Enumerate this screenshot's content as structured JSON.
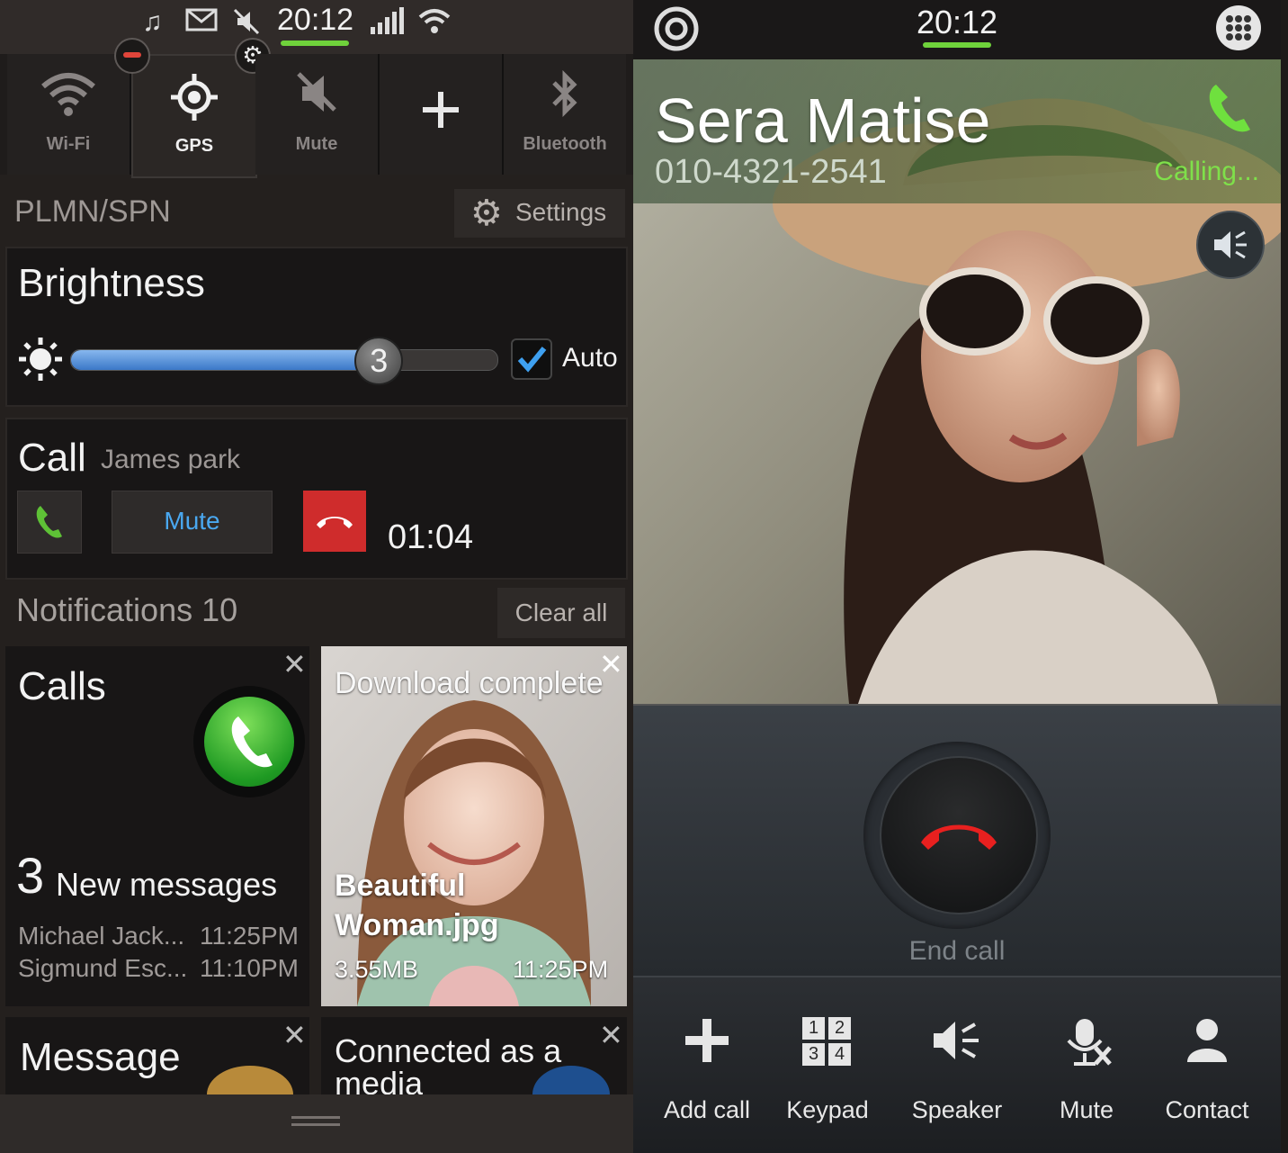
{
  "left_panel": {
    "status_bar": {
      "time": "20:12"
    },
    "quick_settings": [
      {
        "label": "Wi-Fi",
        "icon": "wifi-icon"
      },
      {
        "label": "GPS",
        "icon": "gps-icon"
      },
      {
        "label": "Mute",
        "icon": "mute-icon"
      },
      {
        "label": "",
        "icon": "add-icon"
      },
      {
        "label": "Bluetooth",
        "icon": "bluetooth-icon"
      }
    ],
    "carrier": "PLMN/SPN",
    "settings_label": "Settings",
    "brightness": {
      "title": "Brightness",
      "level": "3",
      "level_fraction": 0.72,
      "auto_label": "Auto",
      "auto_checked": true
    },
    "call": {
      "title": "Call",
      "name": "James park",
      "mute_label": "Mute",
      "timer": "01:04"
    },
    "notifications": {
      "title": "Notifications 10",
      "clear_label": "Clear all"
    },
    "calls_tile": {
      "title": "Calls",
      "count": "3",
      "new_messages": "New messages",
      "rows": [
        {
          "name": "Michael Jack...",
          "time": "11:25PM"
        },
        {
          "name": "Sigmund Esc...",
          "time": "11:10PM"
        }
      ]
    },
    "download_tile": {
      "title": "Download complete",
      "file": "Beautiful Woman.jpg",
      "size": "3.55MB",
      "time": "11:25PM"
    },
    "message_tile": {
      "title": "Message"
    },
    "connected_tile": {
      "title": "Connected as a media"
    }
  },
  "right_panel": {
    "status_bar": {
      "time": "20:12"
    },
    "caller": {
      "name": "Sera Matise",
      "number": "010-4321-2541",
      "status": "Calling..."
    },
    "end_call_label": "End call",
    "actions": [
      {
        "label": "Add call",
        "icon": "add-call-icon"
      },
      {
        "label": "Keypad",
        "icon": "keypad-icon"
      },
      {
        "label": "Speaker",
        "icon": "speaker-icon"
      },
      {
        "label": "Mute",
        "icon": "mic-mute-icon"
      },
      {
        "label": "Contact",
        "icon": "contact-icon"
      }
    ],
    "keypad_digits": [
      "1",
      "2",
      "3",
      "4"
    ]
  },
  "colors": {
    "accent_green": "#6fd23b",
    "mute_blue": "#4aa8f0",
    "end_red": "#cf2c2c"
  }
}
